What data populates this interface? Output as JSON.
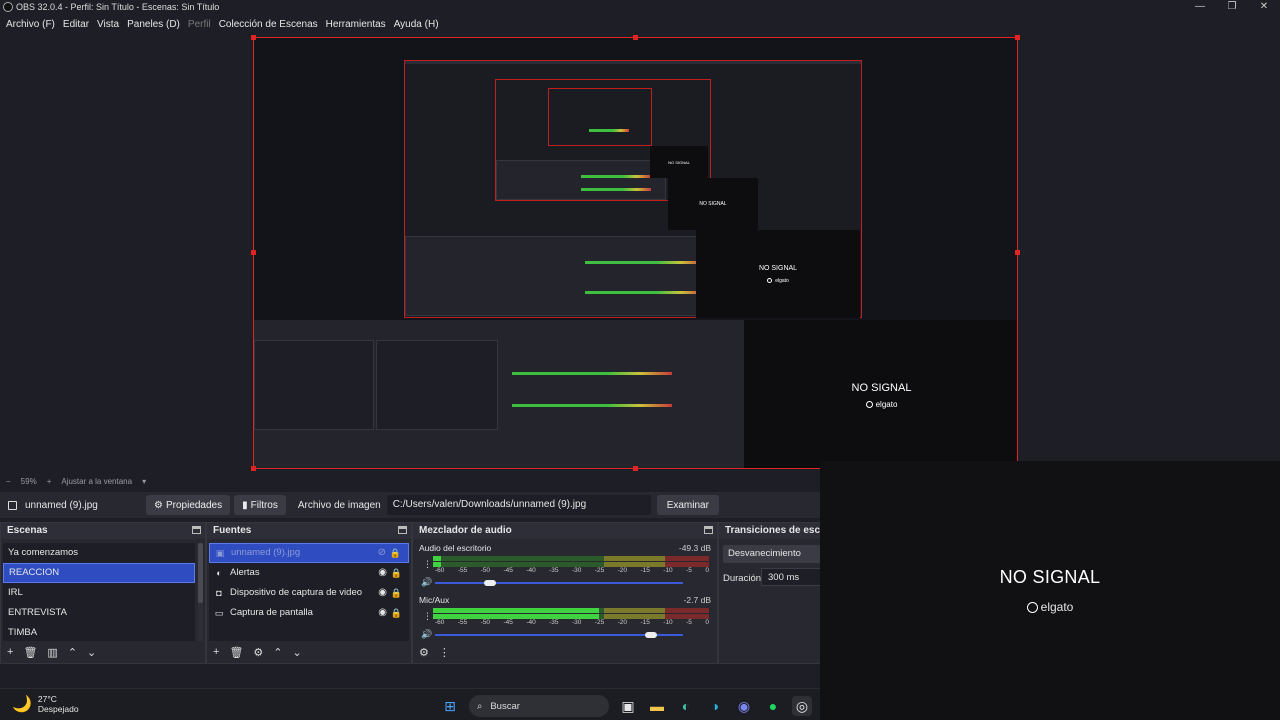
{
  "window": {
    "title": "OBS 32.0.4 - Perfil: Sin Título - Escenas: Sin Título",
    "controls": [
      "—",
      "❐",
      "✕"
    ]
  },
  "menu": [
    "Archivo (F)",
    "Editar",
    "Vista",
    "Paneles (D)",
    "Perfil",
    "Colección de Escenas",
    "Herramientas",
    "Ayuda (H)"
  ],
  "zoombar": {
    "minus": "−",
    "zoom": "59%",
    "plus": "+",
    "fit": "Ajustar a la ventana"
  },
  "source_toolbar": {
    "source_name": "unnamed (9).jpg",
    "properties": "Propiedades",
    "filters": "Filtros",
    "image_label": "Archivo de imagen",
    "path": "C:/Users/valen/Downloads/unnamed (9).jpg",
    "browse": "Examinar"
  },
  "scenes": {
    "title": "Escenas",
    "items": [
      "Ya comenzamos",
      "REACCION",
      "IRL",
      "ENTREVISTA",
      "TIMBA"
    ],
    "selected": "REACCION"
  },
  "sources": {
    "title": "Fuentes",
    "items": [
      {
        "label": "unnamed (9).jpg",
        "icon": "image-icon"
      },
      {
        "label": "Alertas",
        "icon": "browser-icon"
      },
      {
        "label": "Dispositivo de captura de video",
        "icon": "camera-icon"
      },
      {
        "label": "Captura de pantalla",
        "icon": "monitor-icon"
      }
    ]
  },
  "mixer": {
    "title": "Mezclador de audio",
    "ticks": [
      "-60",
      "-55",
      "-50",
      "-45",
      "-40",
      "-35",
      "-30",
      "-25",
      "-20",
      "-15",
      "-10",
      "-5",
      "0"
    ],
    "channels": [
      {
        "name": "Audio del escritorio",
        "db": "-49.3 dB",
        "level": 0.03,
        "volume": 0.22
      },
      {
        "name": "Mic/Aux",
        "db": "-2.7 dB",
        "level": 0.6,
        "volume": 0.87
      }
    ]
  },
  "transitions": {
    "title": "Transiciones de escena",
    "selected": "Desvanecimiento",
    "duration_label": "Duración",
    "duration": "300 ms"
  },
  "no_signal": {
    "text": "NO SIGNAL",
    "brand": "elgato"
  },
  "taskbar": {
    "temp": "27°C",
    "weather": "Despejado",
    "search": "Buscar"
  },
  "colors": {
    "selection": "#2f4dc1",
    "canvas_border": "#e02424",
    "background": "#1e1f26"
  }
}
